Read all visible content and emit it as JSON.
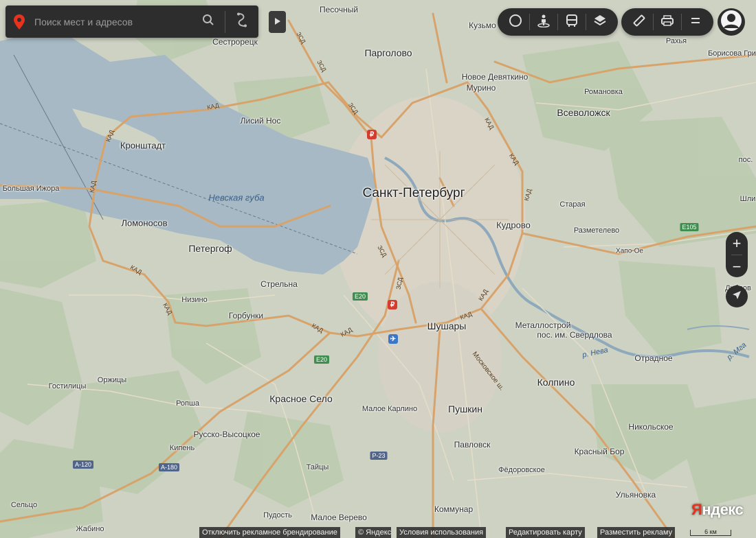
{
  "search": {
    "placeholder": "Поиск мест и адресов"
  },
  "toolbar": {
    "group1": [
      "traffic-circle-icon",
      "panorama-person-icon",
      "transit-bus-icon",
      "layers-icon"
    ],
    "group2": [
      "ruler-icon",
      "print-icon",
      "menu-icon"
    ]
  },
  "zoom": {
    "plus": "+",
    "minus": "−"
  },
  "map": {
    "labels": {
      "spb": "Санкт-Петербург",
      "nevskaya_guba": "Невская губа",
      "kronshtadt": "Кронштадт",
      "lomonosov": "Ломоносов",
      "petergof": "Петергоф",
      "strelna": "Стрельна",
      "nizino": "Низино",
      "gorbunki": "Горбунки",
      "bolshaya_izhora": "Большая Ижора",
      "sestroretsk": "Сестрорецк",
      "pesochny": "Песочный",
      "pargolovo": "Парголово",
      "lisiy_nos": "Лисий Нос",
      "novoe_devyatkino": "Новое Девяткино",
      "murino": "Мурино",
      "kuzmo": "Кузьмо",
      "vsevolozhsk": "Всеволожск",
      "romanovka": "Романовка",
      "rakhya": "Рахья",
      "borisova_griva": "Борисова Гри",
      "pos": "пос. ",
      "shli": "Шли",
      "staraya": "Старая",
      "kudrovo": "Кудрово",
      "razmetelevo": "Разметелево",
      "khapo_oe": "Хапо-Ое",
      "dubrov": "Дубров",
      "shushary": "Шушары",
      "metallostroy": "Металлострой",
      "pos_sverdlova": "пос. им. Свердлова",
      "r_neva": "р. Нева",
      "r_mga": "р. Мга",
      "otradnoe": "Отрадное",
      "kolpino": "Колпино",
      "pushkin": "Пушкин",
      "moskovskoe_sh": "Московское ш.",
      "malye_karlino": "Малое Карлино",
      "krasnoe_selo": "Красное Село",
      "orzhitsy": "Оржицы",
      "gostilitsy": "Гостилицы",
      "ropsha": "Ропша",
      "russko_vysotskoe": "Русско-Высоцкое",
      "kipen": "Кипень",
      "taitsy": "Тайцы",
      "pavlovsk": "Павловск",
      "nikolskoe": "Никольское",
      "krasny_bor": "Красный Бор",
      "fedorovskoe": "Фёдоровское",
      "ulyanovka": "Ульяновка",
      "kommunar": "Коммунар",
      "maloe_verevo": "Малое Верево",
      "pudost": "Пудость",
      "seltso": "Сельцо",
      "zhabino": "Жабино"
    },
    "roads": {
      "kad": "КАД",
      "zsd": "ЗСД"
    },
    "shields": {
      "e20": "E20",
      "e105": "E105",
      "a120": "A-120",
      "a180": "A-180",
      "r23": "P-23"
    }
  },
  "footer": {
    "branding": "Отключить рекламное брендирование",
    "copyright": "© Яндекс",
    "terms": "Условия использования",
    "edit_map": "Редактировать карту",
    "ads": "Разместить рекламу",
    "scale": "6 км"
  },
  "logo": {
    "first": "Я",
    "rest": "ндекс"
  }
}
